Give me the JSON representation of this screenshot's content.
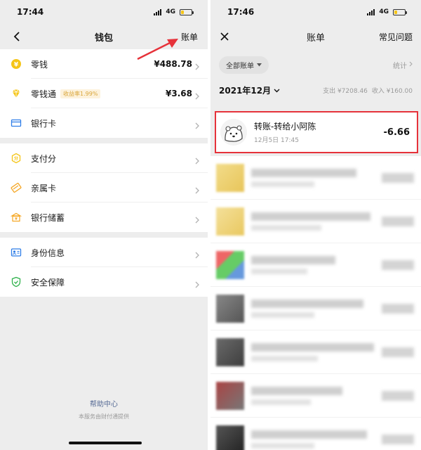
{
  "wallet": {
    "status_time": "17:44",
    "network": "4G",
    "title": "钱包",
    "bill_link": "账单",
    "rows": [
      {
        "label": "零钱",
        "value": "¥488.78",
        "icon": "coin-icon",
        "color": "#f5c518"
      },
      {
        "label": "零钱通",
        "badge": "收益率1.99%",
        "value": "¥3.68",
        "icon": "diamond-icon",
        "color": "#f5c518"
      },
      {
        "label": "银行卡",
        "icon": "bank-card-icon",
        "color": "#2f7ee8"
      },
      {
        "label": "支付分",
        "icon": "credit-score-icon",
        "color": "#f5c518"
      },
      {
        "label": "亲属卡",
        "icon": "family-card-icon",
        "color": "#f5a623"
      },
      {
        "label": "银行储蓄",
        "icon": "savings-icon",
        "color": "#f5a623"
      },
      {
        "label": "身份信息",
        "icon": "id-card-icon",
        "color": "#2f7ee8"
      },
      {
        "label": "安全保障",
        "icon": "shield-icon",
        "color": "#2fb24c"
      }
    ],
    "help_center": "帮助中心",
    "provider_note": "本服务由财付通提供"
  },
  "bill": {
    "status_time": "17:46",
    "network": "4G",
    "title": "账单",
    "faq_link": "常见问题",
    "filter_chip": "全部账单",
    "stats_link": "统计",
    "month": "2021年12月",
    "expense_total": "支出 ¥7208.46",
    "income_total": "收入 ¥160.00",
    "highlight_color": "#e6323a",
    "transaction": {
      "title": "转账-转给小阿陈",
      "time": "12月5日 17:45",
      "amount": "-6.66"
    }
  }
}
